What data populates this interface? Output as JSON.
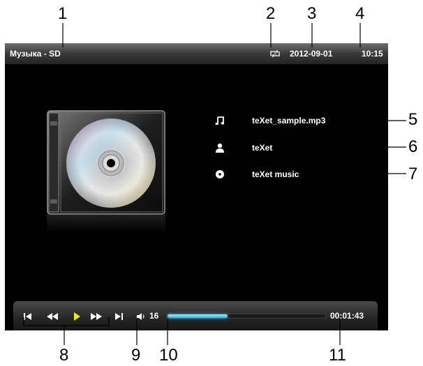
{
  "callouts": [
    "1",
    "2",
    "3",
    "4",
    "5",
    "6",
    "7",
    "8",
    "9",
    "10",
    "11"
  ],
  "status_bar": {
    "title": "Музыка - SD",
    "date": "2012-09-01",
    "time": "10:15",
    "repeat_icon": "repeat-all-icon"
  },
  "track": {
    "file_name": "teXet_sample.mp3",
    "artist": "teXet",
    "album": "teXet music",
    "icons": [
      "music-note-icon",
      "person-icon",
      "disc-icon"
    ]
  },
  "player": {
    "volume": "16",
    "elapsed": "00:01:43",
    "progress": 0.38,
    "controls": [
      "previous-track-icon",
      "rewind-icon",
      "play-icon",
      "fast-forward-icon",
      "next-track-icon"
    ]
  },
  "colors": {
    "screen_bg": "#000000",
    "text": "#ffffff",
    "play_accent": "#e8f000",
    "progress_fill": "#18b6e8"
  }
}
